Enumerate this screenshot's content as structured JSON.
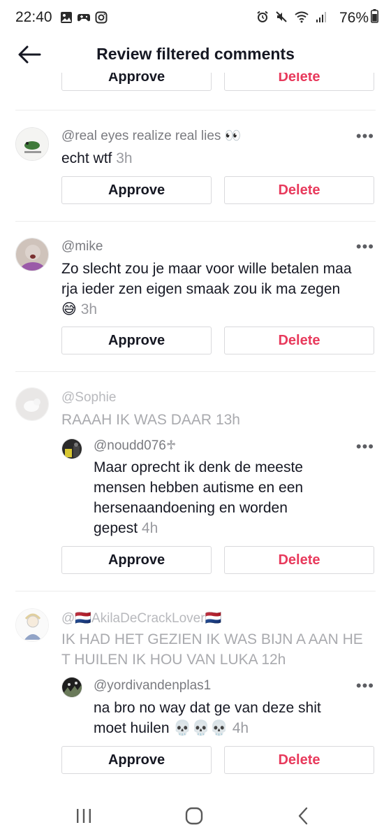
{
  "status_bar": {
    "time": "22:40",
    "battery": "76%",
    "left_icons": [
      "gallery-icon",
      "game-controller-icon",
      "instagram-icon"
    ],
    "right_icons": [
      "alarm-icon",
      "mute-icon",
      "wifi-icon",
      "signal-icon",
      "battery-icon"
    ]
  },
  "header": {
    "title": "Review filtered comments"
  },
  "buttons": {
    "approve": "Approve",
    "delete": "Delete"
  },
  "comments": [
    {
      "username": "@real eyes realize real lies 👀",
      "text": "echt wtf",
      "time": "3h",
      "faded": false
    },
    {
      "username": "@mike",
      "text": "Zo slecht zou je maar voor wille betalen maa\nrja ieder zen eigen smaak zou ik ma zegen\n😅",
      "time": "3h",
      "faded": false
    },
    {
      "username": "@Sophie",
      "text": "RAAAH IK WAS DAAR",
      "time": "13h",
      "faded": true,
      "reply": {
        "username": "@noudd076♱",
        "text": "Maar oprecht ik denk de meeste\nmensen hebben autisme en een\nhersenaandoening en worden\ngepest",
        "time": "4h"
      }
    },
    {
      "username": "@🇳🇱AkilaDeCrackLover🇳🇱",
      "text": "IK HAD HET GEZIEN IK WAS BIJN A AAN HE\nT HUILEN IK HOU VAN LUKA",
      "time": "12h",
      "faded": true,
      "reply": {
        "username": "@yordivandenplas1",
        "text": "na bro no way dat ge van deze shit\nmoet huilen 💀💀💀",
        "time": "4h"
      }
    }
  ],
  "nav_bar": {
    "icons": [
      "recent-apps-icon",
      "home-icon",
      "back-nav-icon"
    ]
  }
}
